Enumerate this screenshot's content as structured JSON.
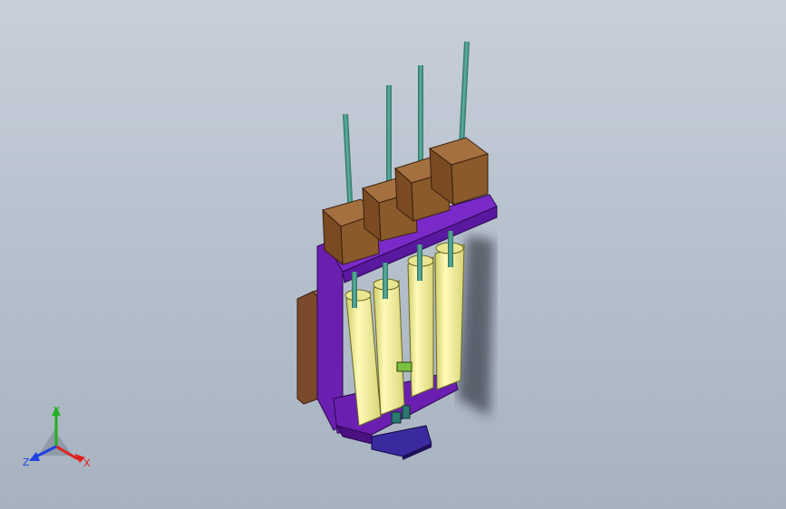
{
  "triad": {
    "x_label": "X",
    "y_label": "Y",
    "z_label": "Z",
    "x_color": "#e02020",
    "y_color": "#20b020",
    "z_color": "#2040e0"
  },
  "model": {
    "motor_color": "#8a5a2a",
    "frame_color": "#6a1fb0",
    "syringe_color": "#f4f29a",
    "rod_color": "#3f8f80",
    "bracket_color": "#7a4a2a",
    "base_color": "#3a2aa0"
  }
}
